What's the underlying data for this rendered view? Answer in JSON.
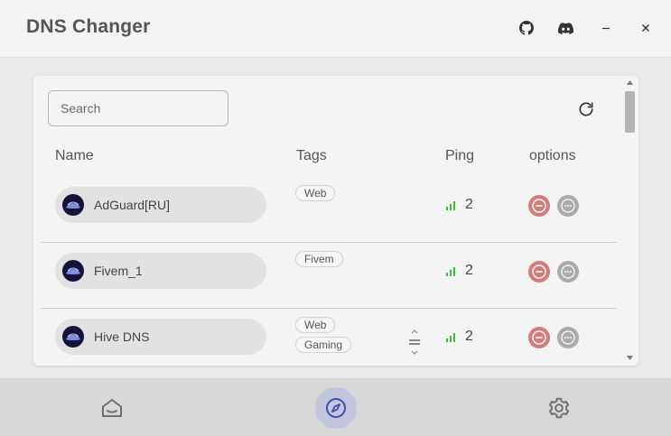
{
  "app": {
    "title": "DNS Changer"
  },
  "search": {
    "placeholder": "Search",
    "value": ""
  },
  "columns": {
    "name": "Name",
    "tags": "Tags",
    "ping": "Ping",
    "options": "options"
  },
  "rows": [
    {
      "name": "AdGuard[RU]",
      "tags": [
        "Web"
      ],
      "ping": "2"
    },
    {
      "name": "Fivem_1",
      "tags": [
        "Fivem"
      ],
      "ping": "2"
    },
    {
      "name": "Hive DNS",
      "tags": [
        "Web",
        "Gaming"
      ],
      "ping": "2"
    }
  ],
  "icons": {
    "github": "github-icon",
    "discord": "discord-icon",
    "minimize": "minimize-icon",
    "close": "close-icon",
    "refresh": "refresh-icon",
    "signal": "signal-bars-icon",
    "remove": "remove-icon",
    "more": "more-icon",
    "home": "home-icon",
    "explore": "compass-icon",
    "settings": "gear-icon"
  },
  "colors": {
    "accent": "#3d4db0",
    "ping_good": "#3cbf3c",
    "remove": "#d27c7c",
    "more": "#ababab"
  }
}
